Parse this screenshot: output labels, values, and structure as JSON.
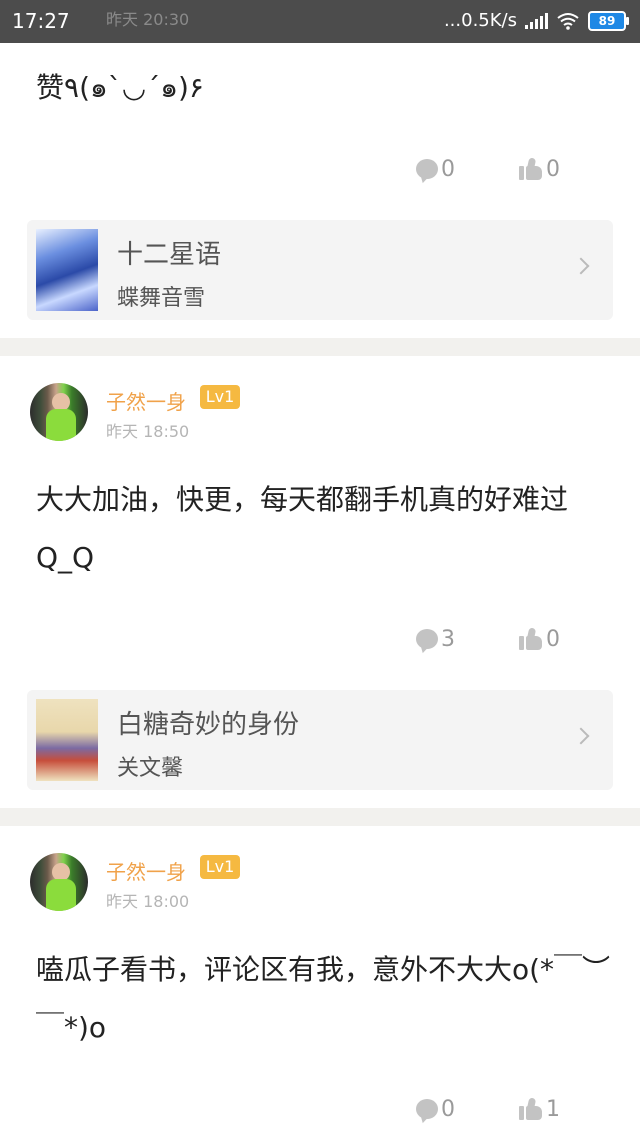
{
  "status_bar": {
    "time": "17:27",
    "ghost_time": "昨天 20:30",
    "net_speed": "...0.5K/s",
    "battery": "89"
  },
  "comments": [
    {
      "text": "赞٩(๑`◡´๑)۶",
      "reply_count": "0",
      "like_count": "0",
      "book": {
        "title": "十二星语",
        "author": "蝶舞音雪"
      }
    },
    {
      "username": "子然一身",
      "level": "Lv1",
      "time": "昨天 18:50",
      "text": "大大加油，快更，每天都翻手机真的好难过Q_Q",
      "reply_count": "3",
      "like_count": "0",
      "book": {
        "title": "白糖奇妙的身份",
        "author": "关文馨"
      }
    },
    {
      "username": "子然一身",
      "level": "Lv1",
      "time": "昨天 18:00",
      "text": "嗑瓜子看书，评论区有我，意外不大大o(*￣︶￣*)o",
      "reply_count": "0",
      "like_count": "1"
    }
  ],
  "icons": {
    "reply": "comment-bubble-icon",
    "like": "thumbs-up-icon",
    "book_arrow": "chevron-right-icon",
    "signal": "signal-icon",
    "wifi": "wifi-icon",
    "battery": "battery-icon"
  },
  "colors": {
    "username": "#f0a24a",
    "level_badge": "#f5b941",
    "divider": "#f2f1ee",
    "status_bar": "#4c4c4c"
  }
}
